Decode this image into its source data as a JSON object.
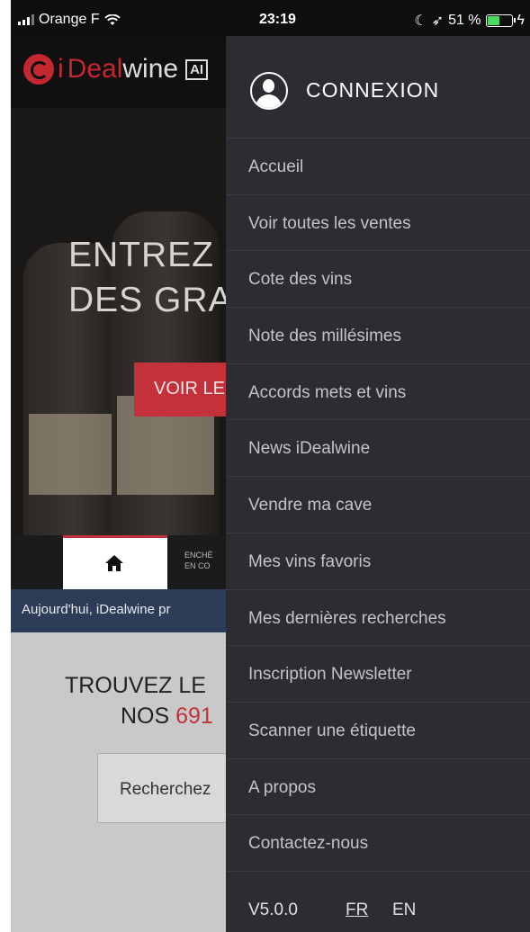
{
  "status_bar": {
    "carrier": "Orange F",
    "time": "23:19",
    "battery": "51 %",
    "battery_level": 0.51
  },
  "app": {
    "logo_i": "i",
    "logo_deal": "Deal",
    "logo_wine": "wine",
    "logo_badge": "AI",
    "hero_line1": "ENTREZ D",
    "hero_line2": "DES GRAN",
    "hero_cta": "VOIR LE",
    "tab_encheres_line1": "ENCHÈ",
    "tab_encheres_line2": "EN CO",
    "ticker": "Aujourd'hui, iDealwine pr",
    "find_title": "TROUVEZ LE",
    "find_sub_prefix": "NOS ",
    "find_sub_number": "691",
    "search_placeholder": "Recherchez"
  },
  "drawer": {
    "connexion": "CONNEXION",
    "menu": [
      "Accueil",
      "Voir toutes les ventes",
      "Cote des vins",
      "Note des millésimes",
      "Accords mets et vins",
      "News iDealwine",
      "Vendre ma cave",
      "Mes vins favoris",
      "Mes dernières recherches",
      "Inscription Newsletter",
      "Scanner une étiquette",
      "A propos",
      "Contactez-nous"
    ],
    "version": "V5.0.0",
    "lang_fr": "FR",
    "lang_en": "EN"
  },
  "colors": {
    "brand_red": "#c3323a",
    "drawer_bg": "#2c2c33",
    "ticker_bg": "#2d3d58"
  }
}
